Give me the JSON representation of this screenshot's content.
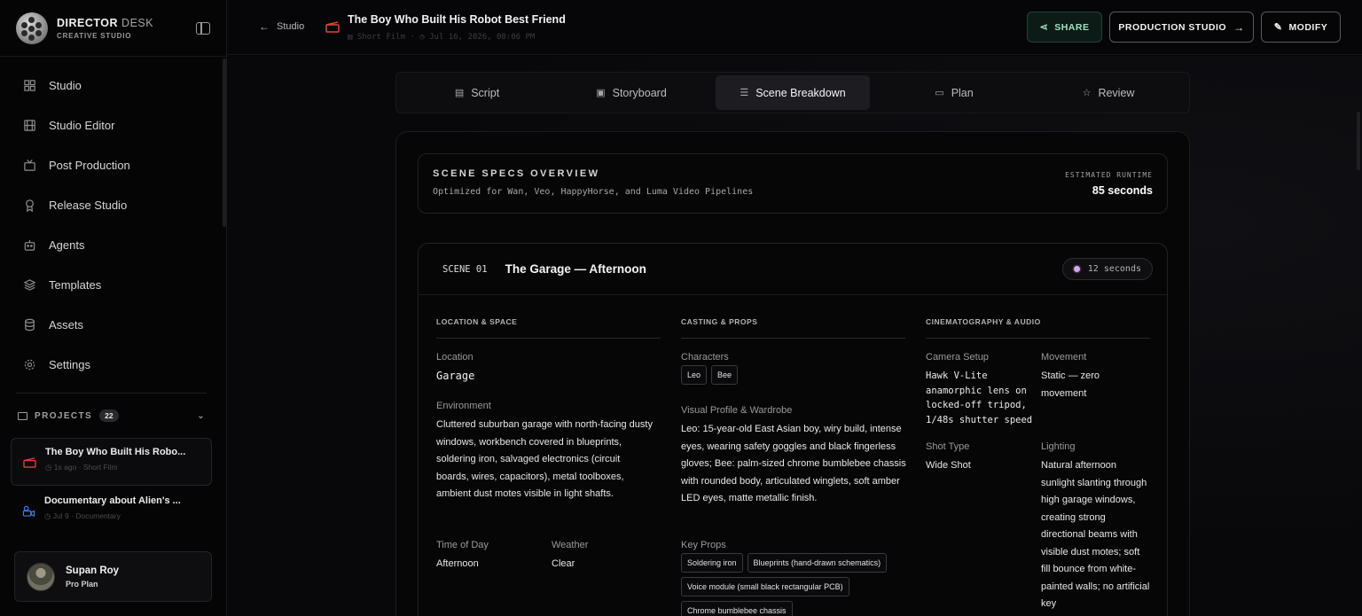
{
  "brand": {
    "title_bold": "DIRECTOR",
    "title_light": "DESK",
    "subtitle": "CREATIVE STUDIO"
  },
  "nav": [
    {
      "label": "Studio",
      "icon": "grid-icon"
    },
    {
      "label": "Studio Editor",
      "icon": "film-icon"
    },
    {
      "label": "Post Production",
      "icon": "tv-icon"
    },
    {
      "label": "Release Studio",
      "icon": "award-icon"
    },
    {
      "label": "Agents",
      "icon": "bot-icon"
    },
    {
      "label": "Templates",
      "icon": "layers-icon"
    },
    {
      "label": "Assets",
      "icon": "database-icon"
    },
    {
      "label": "Settings",
      "icon": "gear-icon"
    }
  ],
  "projects": {
    "heading": "PROJECTS",
    "count": "22",
    "items": [
      {
        "title": "The Boy Who Built His Robo...",
        "meta": "◷ 1s ago · Short Film"
      },
      {
        "title": "Documentary about Alien's ...",
        "meta": "◷ Jul 9 · Documentary"
      }
    ]
  },
  "user": {
    "name": "Supan Roy",
    "plan": "Pro Plan"
  },
  "header": {
    "back_label": "Studio",
    "project_title": "The Boy Who Built His Robot Best Friend",
    "project_meta": "▤ Short Film  ·  ◷ Jul 16, 2026, 08:06 PM",
    "share_label": "SHARE",
    "production_label": "PRODUCTION STUDIO",
    "modify_label": "MODIFY"
  },
  "tabs": [
    {
      "label": "Script",
      "icon": "▤"
    },
    {
      "label": "Storyboard",
      "icon": "▣"
    },
    {
      "label": "Scene Breakdown",
      "icon": "☰"
    },
    {
      "label": "Plan",
      "icon": "▭"
    },
    {
      "label": "Review",
      "icon": "☆"
    }
  ],
  "specs": {
    "title": "SCENE SPECS OVERVIEW",
    "subtitle": "Optimized for Wan, Veo, HappyHorse, and Luma Video Pipelines",
    "runtime_label": "ESTIMATED RUNTIME",
    "runtime_value": "85 seconds"
  },
  "scene": {
    "number": "SCENE 01",
    "title": "The Garage — Afternoon",
    "duration": "12 seconds",
    "location_space": {
      "heading": "LOCATION & SPACE",
      "location_label": "Location",
      "location_value": "Garage",
      "environment_label": "Environment",
      "environment_value": "Cluttered suburban garage with north-facing dusty windows, workbench covered in blueprints, soldering iron, salvaged electronics (circuit boards, wires, capacitors), metal toolboxes, ambient dust motes visible in light shafts.",
      "time_label": "Time of Day",
      "time_value": "Afternoon",
      "weather_label": "Weather",
      "weather_value": "Clear"
    },
    "casting_props": {
      "heading": "CASTING & PROPS",
      "characters_label": "Characters",
      "characters": [
        "Leo",
        "Bee"
      ],
      "profile_label": "Visual Profile & Wardrobe",
      "profile_value": "Leo: 15-year-old East Asian boy, wiry build, intense eyes, wearing safety goggles and black fingerless gloves; Bee: palm-sized chrome bumblebee chassis with rounded body, articulated winglets, soft amber LED eyes, matte metallic finish.",
      "props_label": "Key Props",
      "props": [
        "Soldering iron",
        "Blueprints (hand-drawn schematics)",
        "Voice module (small black rectangular PCB)",
        "Chrome bumblebee chassis"
      ]
    },
    "cinematography": {
      "heading": "CINEMATOGRAPHY & AUDIO",
      "camera_label": "Camera Setup",
      "camera_value": "Hawk V-Lite anamorphic lens on locked-off tripod, 1/48s shutter speed",
      "movement_label": "Movement",
      "movement_value": "Static — zero movement",
      "shot_label": "Shot Type",
      "shot_value": "Wide Shot",
      "lighting_label": "Lighting",
      "lighting_value": "Natural afternoon sunlight slanting through high garage windows, creating strong directional beams with visible dust motes; soft fill bounce from white-painted walls; no artificial key"
    }
  }
}
